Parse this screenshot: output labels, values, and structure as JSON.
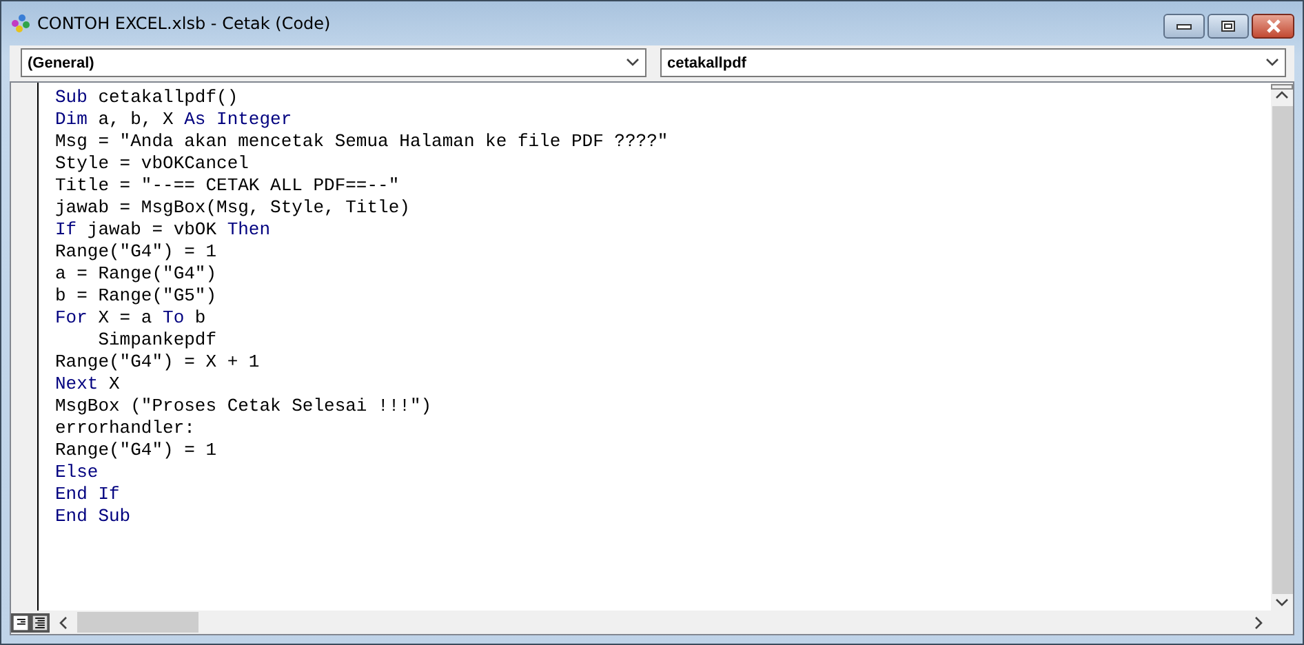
{
  "window": {
    "title": "CONTOH EXCEL.xlsb - Cetak (Code)"
  },
  "object_dropdown": {
    "value": "(General)"
  },
  "procedure_dropdown": {
    "value": "cetakallpdf"
  },
  "code_lines": [
    [
      {
        "kind": "keyword",
        "text": "Sub"
      },
      {
        "kind": "plain",
        "text": " cetakallpdf()"
      }
    ],
    [
      {
        "kind": "keyword",
        "text": "Dim"
      },
      {
        "kind": "plain",
        "text": " a, b, X "
      },
      {
        "kind": "keyword",
        "text": "As Integer"
      }
    ],
    [
      {
        "kind": "plain",
        "text": "Msg = \"Anda akan mencetak Semua Halaman ke file PDF ????\""
      }
    ],
    [
      {
        "kind": "plain",
        "text": "Style = vbOKCancel"
      }
    ],
    [
      {
        "kind": "plain",
        "text": "Title = \"--== CETAK ALL PDF==--\""
      }
    ],
    [
      {
        "kind": "plain",
        "text": "jawab = MsgBox(Msg, Style, Title)"
      }
    ],
    [
      {
        "kind": "keyword",
        "text": "If"
      },
      {
        "kind": "plain",
        "text": " jawab = vbOK "
      },
      {
        "kind": "keyword",
        "text": "Then"
      }
    ],
    [
      {
        "kind": "plain",
        "text": "Range(\"G4\") = 1"
      }
    ],
    [
      {
        "kind": "plain",
        "text": "a = Range(\"G4\")"
      }
    ],
    [
      {
        "kind": "plain",
        "text": "b = Range(\"G5\")"
      }
    ],
    [
      {
        "kind": "keyword",
        "text": "For"
      },
      {
        "kind": "plain",
        "text": " X = a "
      },
      {
        "kind": "keyword",
        "text": "To"
      },
      {
        "kind": "plain",
        "text": " b"
      }
    ],
    [
      {
        "kind": "plain",
        "text": "    Simpankepdf"
      }
    ],
    [
      {
        "kind": "plain",
        "text": "Range(\"G4\") = X + 1"
      }
    ],
    [
      {
        "kind": "keyword",
        "text": "Next"
      },
      {
        "kind": "plain",
        "text": " X"
      }
    ],
    [
      {
        "kind": "plain",
        "text": "MsgBox (\"Proses Cetak Selesai !!!\")"
      }
    ],
    [
      {
        "kind": "plain",
        "text": "errorhandler:"
      }
    ],
    [
      {
        "kind": "plain",
        "text": "Range(\"G4\") = 1"
      }
    ],
    [
      {
        "kind": "keyword",
        "text": "Else"
      }
    ],
    [
      {
        "kind": "keyword",
        "text": "End If"
      }
    ],
    [
      {
        "kind": "keyword",
        "text": "End Sub"
      }
    ]
  ]
}
